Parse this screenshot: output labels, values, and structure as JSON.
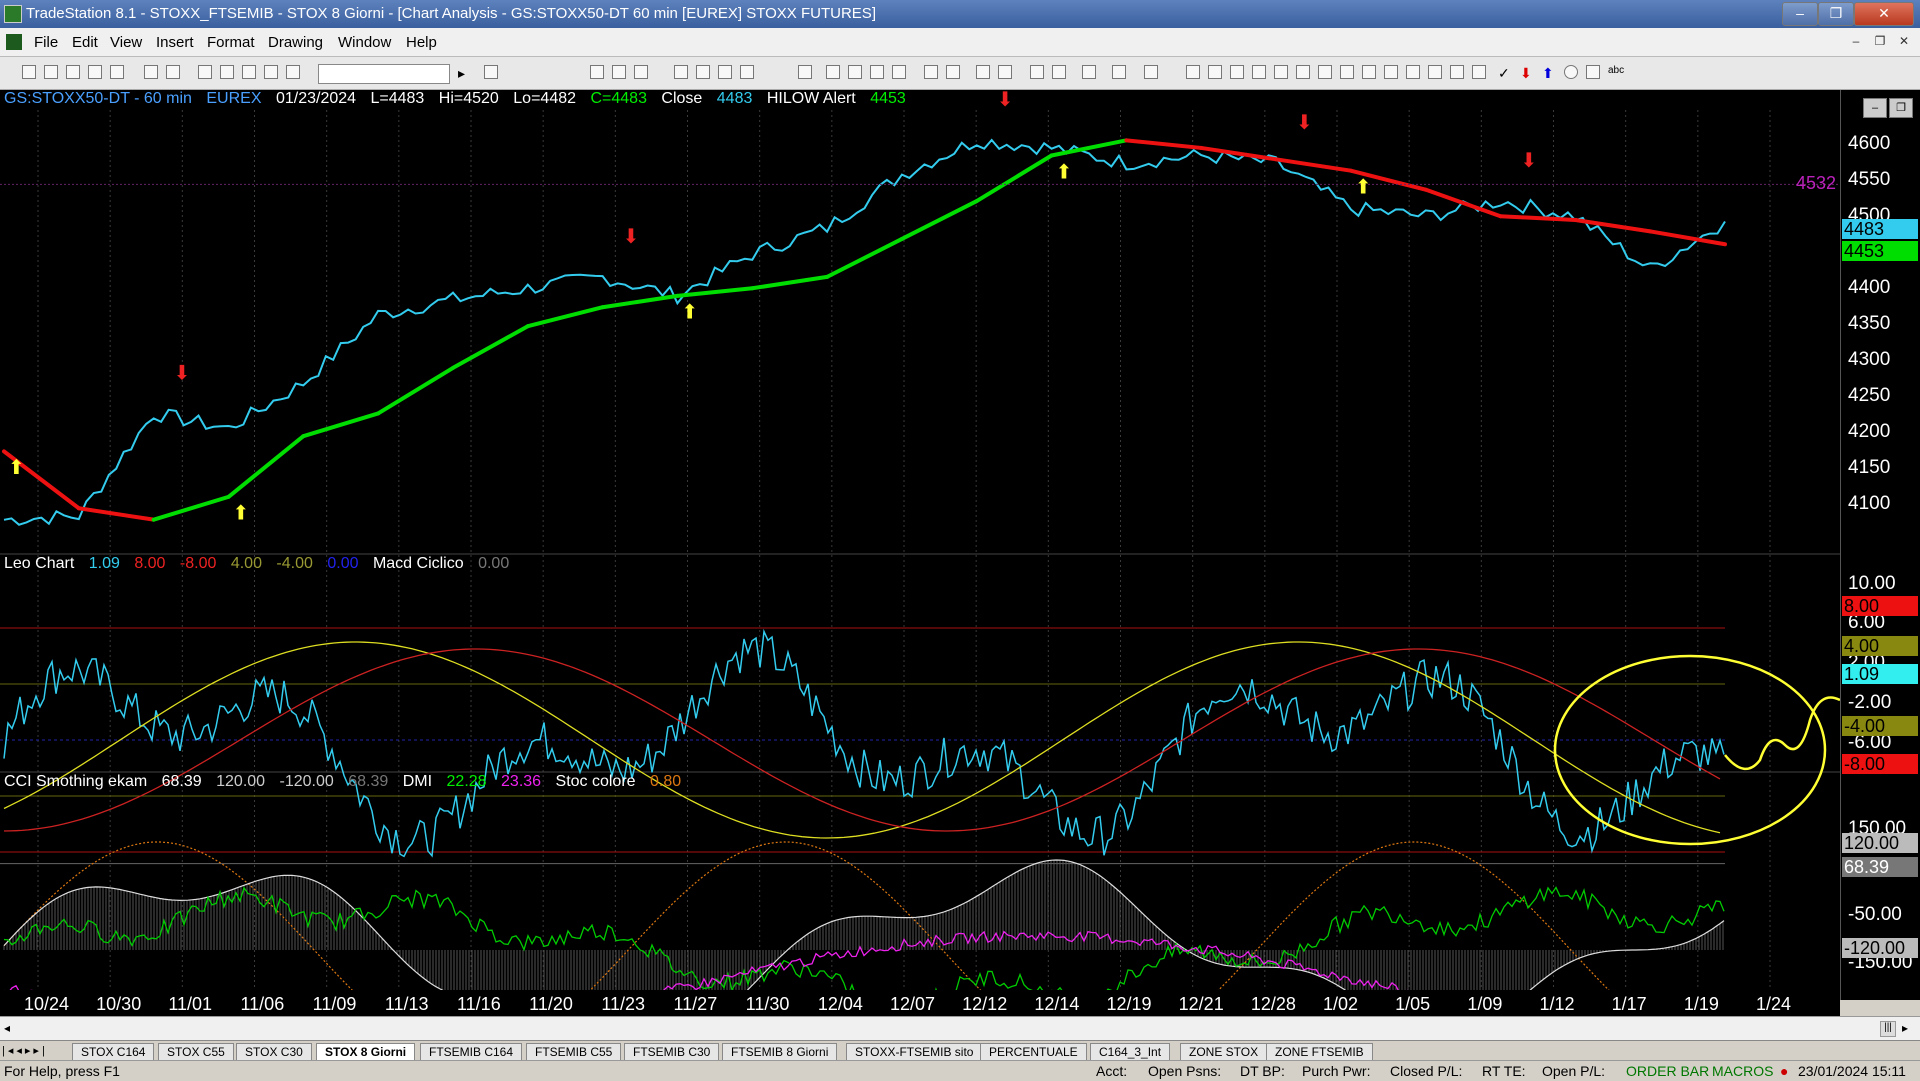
{
  "window": {
    "title": "TradeStation 8.1 - STOXX_FTSEMIB - STOX  8 Giorni - [Chart Analysis - GS:STOXX50-DT  60 min  [EUREX] STOXX FUTURES]",
    "minimize": "‒",
    "maximize": "❐",
    "close": "✕"
  },
  "menu": [
    "File",
    "Edit",
    "View",
    "Insert",
    "Format",
    "Drawing",
    "Window",
    "Help"
  ],
  "chart_header": {
    "symbol": "GS:STOXX50-DT - 60 min",
    "exchange": "EUREX",
    "date": "01/23/2024",
    "last": "L=4483",
    "high": "Hi=4520",
    "low": "Lo=4482",
    "close": "C=4483",
    "close_label": "Close",
    "close_value": "4483",
    "hilow_label": "HILOW Alert",
    "hilow_value": "4453"
  },
  "pane2_header": {
    "name": "Leo Chart",
    "v1": "1.09",
    "v2": "8.00",
    "v3": "-8.00",
    "v4": "4.00",
    "v5": "-4.00",
    "v6": "0.00",
    "name2": "Macd Ciclico",
    "v7": "0.00"
  },
  "pane3_header": {
    "name": "CCI Smothing ekam",
    "v1": "68.39",
    "v2": "120.00",
    "v3": "-120.00",
    "v4": "68.39",
    "name2": "DMI",
    "v5": "22.28",
    "v6": "23.36",
    "name3": "Stoc colore",
    "v7": "0.80"
  },
  "price_scale": [
    "4600",
    "4550",
    "4500",
    "4450",
    "4400",
    "4350",
    "4300",
    "4250",
    "4200",
    "4150",
    "4100"
  ],
  "price_boxes": {
    "level": "4532",
    "close": "4483",
    "alert": "4453"
  },
  "osc_scale": [
    "10.00",
    "6.00",
    "2.00",
    "-2.00",
    "-6.00"
  ],
  "osc_boxes": {
    "b1": "8.00",
    "b2": "4.00",
    "b3": "1.09",
    "b4": "-4.00",
    "b5": "-8.00"
  },
  "cci_scale": [
    "150.00",
    "-50.00",
    "-150.00"
  ],
  "cci_boxes": {
    "b1": "120.00",
    "b2": "68.39",
    "b3": "-120.00"
  },
  "x_axis": [
    "10/24",
    "10/30",
    "11/01",
    "11/06",
    "11/09",
    "11/13",
    "11/16",
    "11/20",
    "11/23",
    "11/27",
    "11/30",
    "12/04",
    "12/07",
    "12/12",
    "12/14",
    "12/19",
    "12/21",
    "12/28",
    "1/02",
    "1/05",
    "1/09",
    "1/12",
    "1/17",
    "1/19",
    "1/24"
  ],
  "tabs": [
    "STOX C164",
    "STOX C55",
    "STOX  C30",
    "STOX  8 Giorni",
    "FTSEMIB C164",
    "FTSEMIB C55",
    "FTSEMIB C30",
    "FTSEMIB  8 Giorni",
    "STOXX-FTSEMIB sito",
    "PERCENTUALE",
    "C164_3_Int",
    "ZONE STOX",
    "ZONE FTSEMIB"
  ],
  "active_tab": "STOX  8 Giorni",
  "status": {
    "help": "For Help, press F1",
    "acct": "Acct:",
    "open_psns": "Open Psns:",
    "dt_bp": "DT BP:",
    "purch_pwr": "Purch Pwr:",
    "closed_pl": "Closed P/L:",
    "rt_te": "RT TE:",
    "open_pl": "Open P/L:",
    "order_bar": "ORDER BAR",
    "macros": "MACROS",
    "datetime": "23/01/2024 15:11"
  },
  "colors": {
    "price": "#33ccee",
    "ma_up": "#00dd00",
    "ma_down": "#ee1111",
    "annotation": "#ffff33",
    "magenta": "#ee22ee"
  },
  "chart_data": {
    "type": "line",
    "title": "GS:STOXX50-DT - 60 min",
    "xlabel": "",
    "ylabel": "",
    "categories": [
      "10/24",
      "10/30",
      "11/01",
      "11/06",
      "11/09",
      "11/13",
      "11/16",
      "11/20",
      "11/23",
      "11/27",
      "11/30",
      "12/04",
      "12/07",
      "12/12",
      "12/14",
      "12/19",
      "12/21",
      "12/28",
      "1/02",
      "1/05",
      "1/09",
      "1/12",
      "1/17",
      "1/19"
    ],
    "ylim": [
      4050,
      4630
    ],
    "series": [
      {
        "name": "Close",
        "values": [
          4090,
          4095,
          4230,
          4210,
          4270,
          4360,
          4380,
          4395,
          4410,
          4385,
          4440,
          4475,
          4545,
          4590,
          4580,
          4560,
          4570,
          4560,
          4500,
          4490,
          4510,
          4490,
          4420,
          4483
        ]
      },
      {
        "name": "HILOW Alert",
        "values": [
          4180,
          4105,
          4090,
          4120,
          4200,
          4230,
          4290,
          4345,
          4370,
          4385,
          4395,
          4410,
          4460,
          4510,
          4570,
          4590,
          4580,
          4565,
          4550,
          4525,
          4490,
          4485,
          4470,
          4453
        ]
      }
    ]
  }
}
